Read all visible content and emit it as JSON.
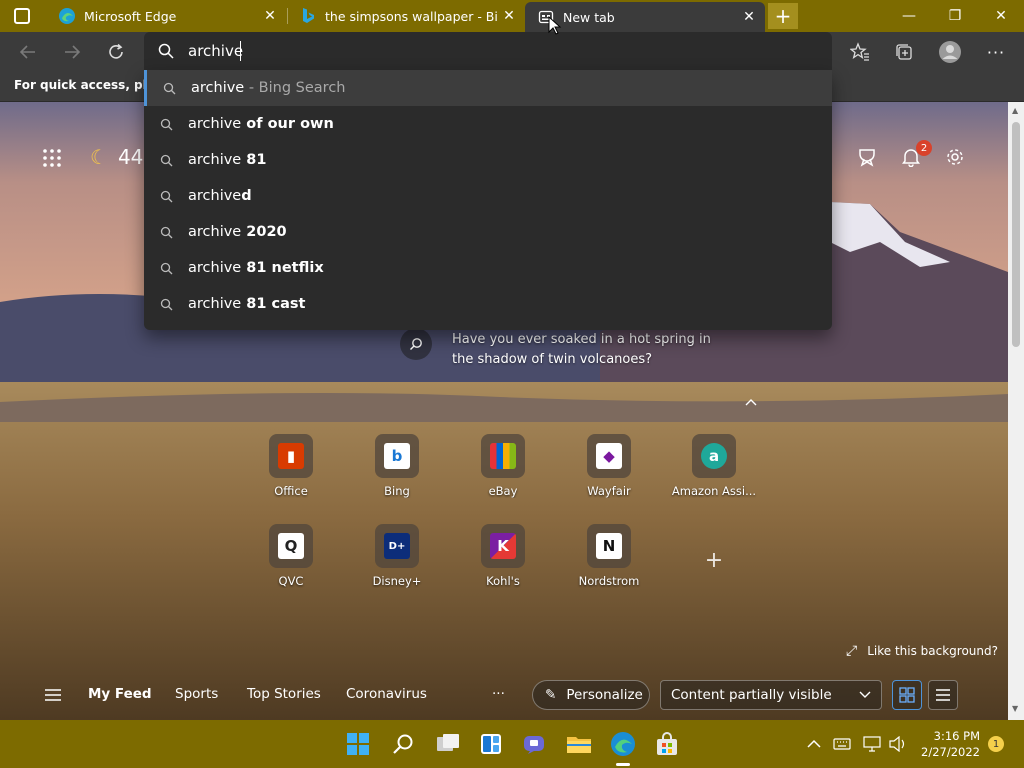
{
  "tabs": [
    {
      "label": "Microsoft Edge",
      "icon": "edge-icon"
    },
    {
      "label": "the simpsons wallpaper - Bing im",
      "icon": "bing-icon"
    },
    {
      "label": "New tab",
      "icon": "newtab-page-icon"
    }
  ],
  "window_controls": {
    "minimize": "—",
    "restore": "❐",
    "close": "✕"
  },
  "address": {
    "value": "archive"
  },
  "favorites_bar": {
    "text": "For quick access, place y"
  },
  "suggestions": [
    {
      "prefix": "archive",
      "suffix": "",
      "hint": " - Bing Search"
    },
    {
      "prefix": "archive",
      "suffix": " of our own",
      "hint": ""
    },
    {
      "prefix": "archive",
      "suffix": " 81",
      "hint": ""
    },
    {
      "prefix": "archive",
      "suffix": "d",
      "hint": ""
    },
    {
      "prefix": "archive",
      "suffix": " 2020",
      "hint": ""
    },
    {
      "prefix": "archive",
      "suffix": " 81 netflix",
      "hint": ""
    },
    {
      "prefix": "archive",
      "suffix": " 81 cast",
      "hint": ""
    }
  ],
  "weather": {
    "temp": "44"
  },
  "notifications": {
    "count": "2"
  },
  "fact": {
    "text": "Have you ever soaked in a hot spring in the shadow of twin volcanoes?"
  },
  "quick_links": [
    {
      "label": "Office",
      "color": "#d83b01",
      "glyph": "▮"
    },
    {
      "label": "Bing",
      "color": "#ffffff",
      "glyph": "b"
    },
    {
      "label": "eBay",
      "color": "#e53238",
      "glyph": "▆"
    },
    {
      "label": "Wayfair",
      "color": "#ffffff",
      "glyph": "◆"
    },
    {
      "label": "Amazon Assi...",
      "color": "#1fa89a",
      "glyph": "a"
    },
    {
      "label": "QVC",
      "color": "#ffffff",
      "glyph": "Q"
    },
    {
      "label": "Disney+",
      "color": "#0c2d7a",
      "glyph": "D+"
    },
    {
      "label": "Kohl's",
      "color": "#ffffff",
      "glyph": "K"
    },
    {
      "label": "Nordstrom",
      "color": "#ffffff",
      "glyph": "N"
    }
  ],
  "background": {
    "like_text": "Like this background?"
  },
  "feed": {
    "items": [
      "My Feed",
      "Sports",
      "Top Stories",
      "Coronavirus"
    ],
    "more": "···",
    "personalize": "Personalize",
    "visibility": "Content partially visible"
  },
  "taskbar": {
    "time": "3:16 PM",
    "date": "2/27/2022",
    "notification_count": "1"
  }
}
